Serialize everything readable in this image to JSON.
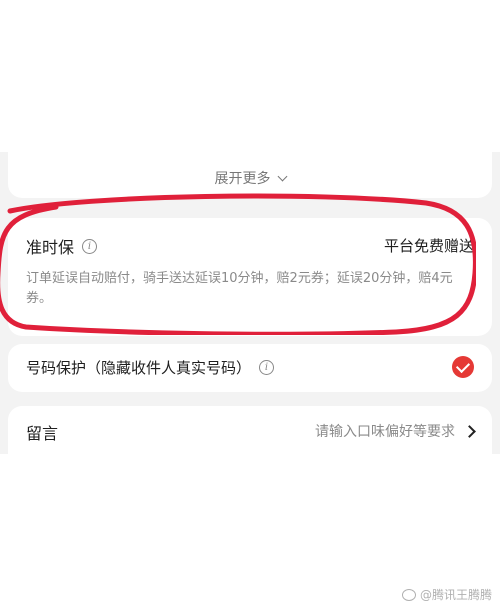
{
  "expand": {
    "label": "展开更多"
  },
  "on_time": {
    "title": "准时保",
    "right_label": "平台免费赠送",
    "description": "订单延误自动赔付，骑手送达延误10分钟，赔2元券；延误20分钟，赔4元券。"
  },
  "privacy": {
    "title": "号码保护（隐藏收件人真实号码）",
    "checked": true
  },
  "note": {
    "title": "留言",
    "placeholder": "请输入口味偏好等要求"
  },
  "watermark": {
    "text": "@腾讯王腾腾"
  },
  "colors": {
    "accent": "#e53935",
    "annotation": "#e0203a"
  }
}
